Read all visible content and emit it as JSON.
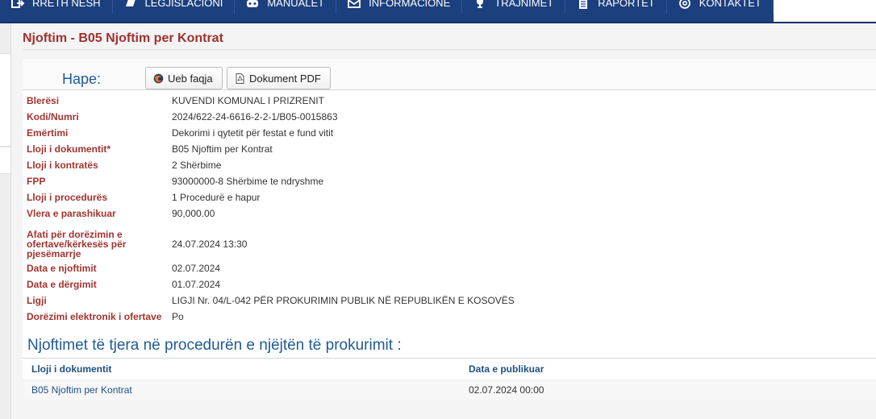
{
  "nav": {
    "items": [
      {
        "label": "RRETH NESH",
        "icon": "login-icon"
      },
      {
        "label": "LEGJISLACIONI",
        "icon": "book-icon"
      },
      {
        "label": "MANUALET",
        "icon": "gamepad-icon"
      },
      {
        "label": "INFORMACIONE",
        "icon": "envelope-icon"
      },
      {
        "label": "TRAJNIMET",
        "icon": "trophy-icon"
      },
      {
        "label": "RAPORTET",
        "icon": "file-icon"
      },
      {
        "label": "KONTAKTET",
        "icon": "at-sign-icon"
      }
    ]
  },
  "page": {
    "title": "Njoftim - B05 Njoftim per Kontrat"
  },
  "open": {
    "label": "Hape:",
    "web_button": "Ueb faqja",
    "pdf_button": "Dokument PDF"
  },
  "details": [
    {
      "label": "Blerësi",
      "value": "KUVENDI KOMUNAL I PRIZRENIT"
    },
    {
      "label": "Kodi/Numri",
      "value": "2024/622-24-6616-2-2-1/B05-0015863"
    },
    {
      "label": "Emërtimi",
      "value": "Dekorimi i qytetit për festat e fund vitit"
    },
    {
      "label": "Lloji i dokumentit*",
      "value": "B05 Njoftim per Kontrat"
    },
    {
      "label": "Lloji i kontratës",
      "value": "2 Shërbime"
    },
    {
      "label": "FPP",
      "value": "93000000-8 Shërbime te ndryshme"
    },
    {
      "label": "Lloji i procedurës",
      "value": "1 Procedurë e hapur"
    },
    {
      "label": "Vlera e parashikuar",
      "value": "90,000.00"
    },
    {
      "label": "Afati për dorëzimin e ofertave/kërkesës për pjesëmarrje",
      "value": "24.07.2024 13:30"
    },
    {
      "label": "Data e njoftimit",
      "value": "02.07.2024"
    },
    {
      "label": "Data e dërgimit",
      "value": "01.07.2024"
    },
    {
      "label": "Ligji",
      "value": "LIGJI Nr. 04/L-042 PËR PROKURIMIN PUBLIK NË REPUBLIKËN E KOSOVËS"
    },
    {
      "label": "Dorëzimi elektronik i ofertave",
      "value": "Po"
    }
  ],
  "other_notices": {
    "title": "Njoftimet të tjera në procedurën e njëjtën të prokurimit :",
    "columns": [
      "Lloji i dokumentit",
      "Data e publikuar"
    ],
    "rows": [
      [
        "B05 Njoftim per Kontrat",
        "02.07.2024 00:00"
      ]
    ]
  },
  "colors": {
    "nav_bg": "#1c3f7e",
    "label_red": "#a23330",
    "link_blue": "#1f5a96"
  }
}
